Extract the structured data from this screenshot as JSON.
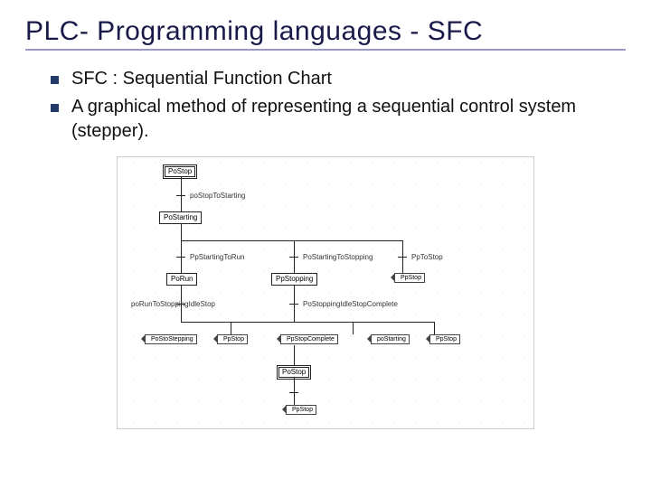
{
  "title": "PLC- Programming languages - SFC",
  "bullets": [
    "SFC : Sequential Function Chart",
    "A graphical method of representing a sequential control system (stepper)."
  ],
  "sfc": {
    "steps": {
      "s_stop_top": "PoStop",
      "s_starting": "PoStarting",
      "s_run": "PoRun",
      "s_stopping": "PpStopping",
      "s_stop_r": "PpStop",
      "s_stop_bot": "PoStop",
      "s_stop_bot2": "PpStop"
    },
    "transitions": {
      "t_stop_starting": "poStopToStarting",
      "t_starting_run": "PpStartingToRun",
      "t_starting_stopping": "PoStartingToStopping",
      "t_to_stop": "PpToStop",
      "t_run_stop1": "poRunToStoppingIdleStop",
      "t_run_stop2": "PoStoppingIdleStopComplete",
      "t_complete": "PpStopComplete",
      "t_starting2": "poStarting",
      "t_stop2": "PpStop"
    },
    "actions": {
      "a_stepping1": "PoStoStepping",
      "a_stop1": "PpStop",
      "a_starting": "poStarting",
      "a_stop2": "PpStop"
    }
  }
}
